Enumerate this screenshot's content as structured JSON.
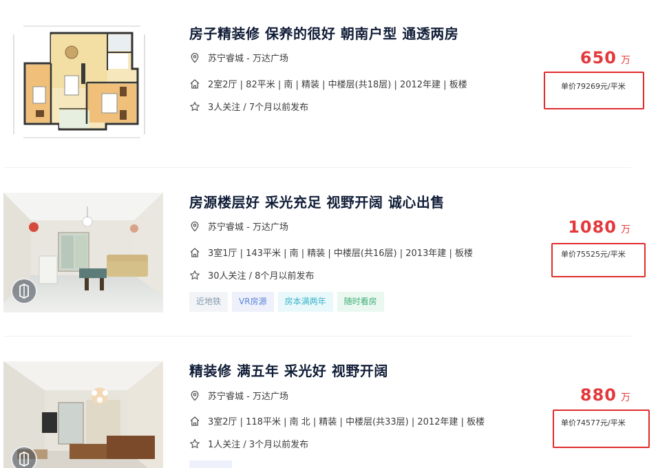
{
  "listings": [
    {
      "title": "房子精装修 保养的很好 朝南户型 通透两房",
      "location": "苏宁睿城 - 万达广场",
      "details": "2室2厅 | 82平米 | 南 | 精装 | 中楼层(共18层) | 2012年建 | 板楼",
      "follow": "3人关注 / 7个月以前发布",
      "price": "650",
      "price_unit": "万",
      "unit_price": "单价79269元/平米",
      "tags": [],
      "image_type": "floorplan"
    },
    {
      "title": "房源楼层好 采光充足 视野开阔 诚心出售",
      "location": "苏宁睿城 - 万达广场",
      "details": "3室1厅 | 143平米 | 南 | 精装 | 中楼层(共16层) | 2013年建 | 板楼",
      "follow": "30人关注 / 8个月以前发布",
      "price": "1080",
      "price_unit": "万",
      "unit_price": "单价75525元/平米",
      "tags": [
        "近地铁",
        "VR房源",
        "房本满两年",
        "随时看房"
      ],
      "image_type": "room-photo"
    },
    {
      "title": "精装修 满五年 采光好 视野开阔",
      "location": "苏宁睿城 - 万达广场",
      "details": "3室2厅 | 118平米 | 南 北 | 精装 | 中楼层(共33层) | 2012年建 | 板楼",
      "follow": "1人关注 / 3个月以前发布",
      "price": "880",
      "price_unit": "万",
      "unit_price": "单价74577元/平米",
      "tags": [],
      "image_type": "room-photo"
    }
  ],
  "icons": {
    "location": "location-pin-icon",
    "details": "house-icon",
    "follow": "star-icon",
    "vr": "vr-icon"
  },
  "colors": {
    "price": "#e4393c",
    "highlight_box": "#e02a2a",
    "title": "#101d37"
  }
}
